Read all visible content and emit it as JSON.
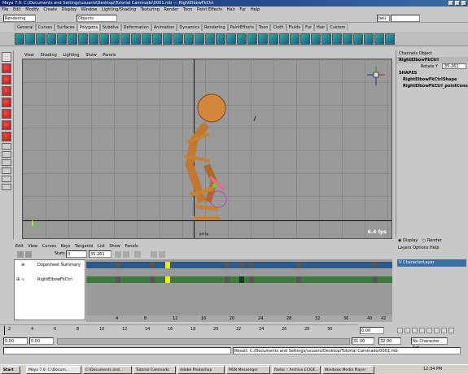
{
  "window": {
    "title": "Maya 7.0: C:\\Documents and Settings\\usuario\\Desktop\\Tutorial Caminado\\0001.mb   ---   RightElbowFkCtrl"
  },
  "menubar": [
    "File",
    "Edit",
    "Modify",
    "Create",
    "Display",
    "Window",
    "Lighting/Shading",
    "Texturing",
    "Render",
    "Toon",
    "Paint Effects",
    "Hair",
    "Fur",
    "Help"
  ],
  "status": {
    "mode": "Rendering",
    "select_field": "Objects",
    "quick_select": "beli"
  },
  "shelf_tabs": [
    "General",
    "Curves",
    "Surfaces",
    "Polygons",
    "Subdivs",
    "Deformation",
    "Animation",
    "Dynamics",
    "Rendering",
    "PaintEffects",
    "Toon",
    "Cloth",
    "Fluids",
    "Fur",
    "Hair",
    "Custom"
  ],
  "active_tab": "Polygons",
  "viewport": {
    "menu": [
      "View",
      "Shading",
      "Lighting",
      "Show",
      "Panels"
    ],
    "fps": "6.4 fps",
    "camera": "persp"
  },
  "channel_box": {
    "menu": [
      "Channels",
      "Object"
    ],
    "object": "RightElbowFkCtrl",
    "attr_name": "Rotate Y",
    "attr_value": "35.261",
    "shapes_label": "SHAPES",
    "shapes": [
      "RightElbowFkCtrlShape",
      "RightElbowFkCtrl_pointConstr"
    ]
  },
  "graph_editor": {
    "menu": [
      "Edit",
      "View",
      "Curves",
      "Keys",
      "Tangents",
      "List",
      "Show",
      "Panels"
    ],
    "stats_label": "Stats",
    "stats_a": "0",
    "stats_b": "35.261",
    "rows": [
      "Dopesheet Summary",
      "RightElbowFkCtrl"
    ]
  },
  "sheet_ruler": [
    "4",
    "8",
    "12",
    "16",
    "20",
    "24",
    "28",
    "32",
    "36",
    "40",
    "42"
  ],
  "layers": {
    "options": [
      "Display",
      "Render"
    ],
    "menu": [
      "Layers",
      "Options",
      "Help"
    ],
    "layer": "CharacterLayer"
  },
  "time_ticks": [
    "2",
    "4",
    "6",
    "8",
    "10",
    "12",
    "14",
    "16",
    "18",
    "20",
    "22",
    "24",
    "26",
    "28",
    "30"
  ],
  "current_frame": "0.00",
  "range": {
    "start_a": "0.00",
    "start_b": "0.00",
    "end_a": "31.00",
    "end_b": "32.00",
    "char_set": "No Character Set"
  },
  "result": "Result: C:/Documents and Settings/usuario/Desktop/Tutorial Caminado/0001.mb",
  "taskbar": {
    "start": "Start",
    "items": [
      "Maya 7.0: C:\\Docum...",
      "C:\\Documents and...",
      "Tutorial Caminado",
      "Adobe Photoshop",
      "MSN Messenger",
      "Radio :: Archivo ECIQE...",
      "Windows Media Player"
    ],
    "clock": "12:34 PM"
  }
}
